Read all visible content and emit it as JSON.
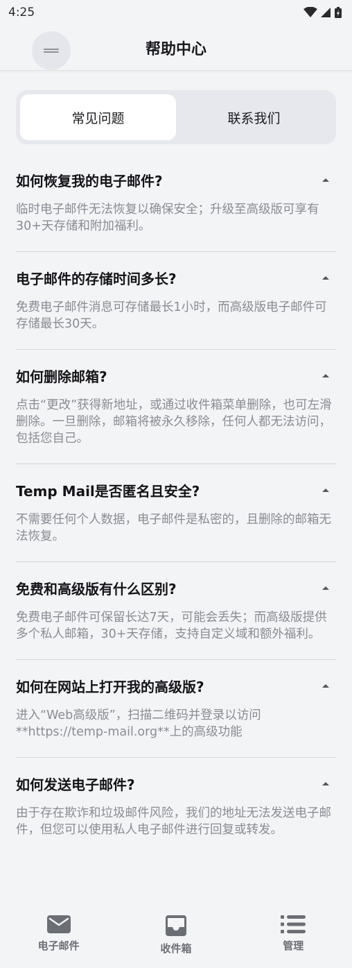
{
  "status_bar": {
    "time": "4:25"
  },
  "header": {
    "title": "帮助中心",
    "menu_icon": "menu-icon"
  },
  "tabs": [
    {
      "label": "常见问题",
      "active": true
    },
    {
      "label": "联系我们",
      "active": false
    }
  ],
  "faq": [
    {
      "question": "如何恢复我的电子邮件?",
      "answer": "临时电子邮件无法恢复以确保安全；升级至高级版可享有30+天存储和附加福利。"
    },
    {
      "question": "电子邮件的存储时间多长?",
      "answer": "免费电子邮件消息可存储最长1小时，而高级版电子邮件可存储最长30天。"
    },
    {
      "question": "如何删除邮箱?",
      "answer": "点击“更改”获得新地址，或通过收件箱菜单删除，也可左滑删除。一旦删除，邮箱将被永久移除，任何人都无法访问，包括您自己。"
    },
    {
      "question": "Temp Mail是否匿名且安全?",
      "answer": "不需要任何个人数据，电子邮件是私密的，且删除的邮箱无法恢复。"
    },
    {
      "question": "免费和高级版有什么区别?",
      "answer": "免费电子邮件可保留长达7天，可能会丢失；而高级版提供多个私人邮箱，30+天存储，支持自定义域和额外福利。"
    },
    {
      "question": "如何在网站上打开我的高级版?",
      "answer": "进入“Web高级版”，扫描二维码并登录以访问**https://temp-mail.org**上的高级功能"
    },
    {
      "question": "如何发送电子邮件?",
      "answer": "由于存在欺诈和垃圾邮件风险，我们的地址无法发送电子邮件，但您可以使用私人电子邮件进行回复或转发。"
    }
  ],
  "bottom_nav": [
    {
      "label": "电子邮件",
      "icon": "mail-icon"
    },
    {
      "label": "收件箱",
      "icon": "inbox-icon"
    },
    {
      "label": "管理",
      "icon": "list-icon"
    }
  ],
  "colors": {
    "background": "#f3f4f6",
    "tab_active": "#ffffff",
    "answer_text": "#8a8c93"
  }
}
